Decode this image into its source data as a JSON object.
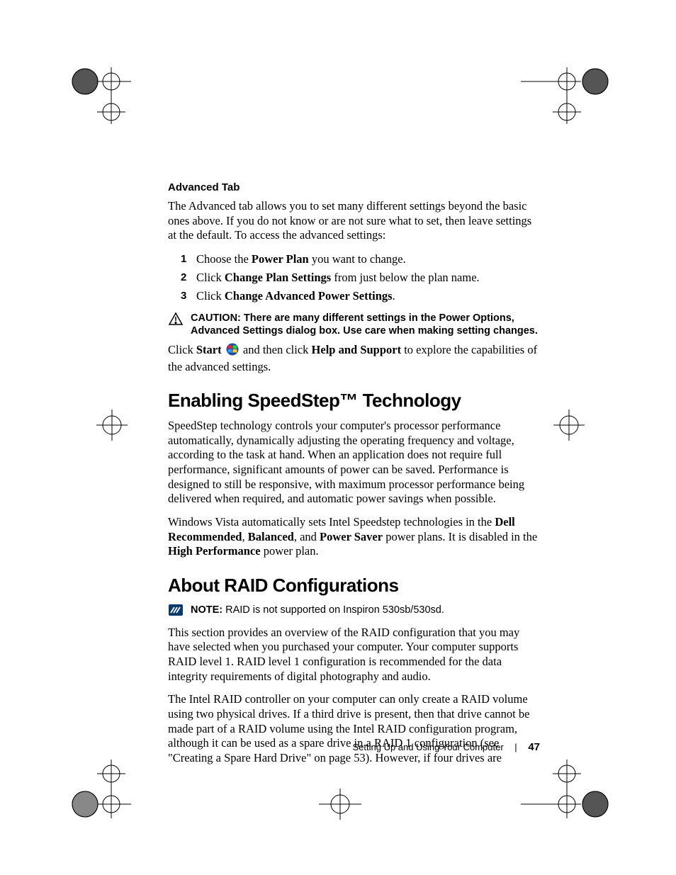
{
  "sections": {
    "advanced_tab": {
      "title": "Advanced Tab",
      "intro": "The Advanced tab allows you to set many different settings beyond the basic ones above. If you do not know or are not sure what to set, then leave settings at the default. To access the advanced settings:",
      "steps": {
        "s1a": "Choose the ",
        "s1b": "Power Plan",
        "s1c": " you want to change.",
        "s2a": "Click ",
        "s2b": "Change Plan Settings",
        "s2c": " from just below the plan name.",
        "s3a": "Click ",
        "s3b": "Change Advanced Power Settings",
        "s3c": "."
      },
      "caution_label": "CAUTION: ",
      "caution_text": "There are many different settings in the Power Options, Advanced Settings dialog box. Use care when making setting changes.",
      "post1a": "Click ",
      "post1b": "Start",
      "post1c": " and then click ",
      "post1d": "Help and Support",
      "post1e": " to explore the capabilities of the advanced settings."
    },
    "speedstep": {
      "title": "Enabling SpeedStep™ Technology",
      "p1": "SpeedStep technology controls your computer's processor performance automatically, dynamically adjusting the operating frequency and voltage, according to the task at hand. When an application does not require full performance, significant amounts of power can be saved. Performance is designed to still be responsive, with maximum processor performance being delivered when required, and automatic power savings when possible.",
      "p2a": "Windows Vista automatically sets Intel Speedstep technologies in the ",
      "p2b": "Dell Recommended",
      "p2c": ", ",
      "p2d": "Balanced",
      "p2e": ", and ",
      "p2f": "Power Saver",
      "p2g": " power plans. It is disabled in the ",
      "p2h": "High Performance",
      "p2i": " power plan."
    },
    "raid": {
      "title": "About RAID Configurations",
      "note_label": "NOTE: ",
      "note_text": "RAID is not supported on Inspiron 530sb/530sd.",
      "p1": "This section provides an overview of the RAID configuration that you may have selected when you purchased your computer. Your computer supports RAID level 1. RAID level 1 configuration is recommended for the data integrity requirements of digital photography and audio.",
      "p2": "The Intel RAID controller on your computer can only create a RAID volume using two physical drives. If a third drive is present, then that drive cannot be made part of a RAID volume using the Intel RAID configuration program, although it can be used as a spare drive in a RAID 1 configuration (see \"Creating a Spare Hard Drive\" on page 53). However, if four drives are"
    }
  },
  "nums": {
    "n1": "1",
    "n2": "2",
    "n3": "3"
  },
  "footer": {
    "chapter": "Setting Up and Using Your Computer",
    "page": "47"
  }
}
